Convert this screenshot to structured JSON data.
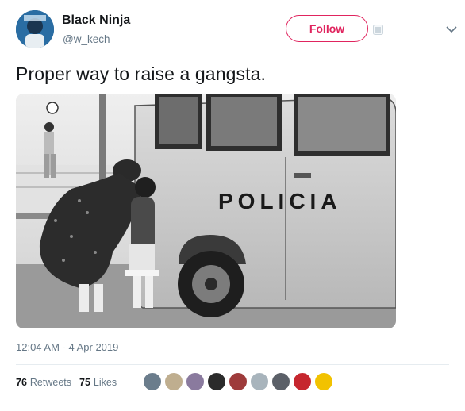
{
  "author": {
    "display_name": "Black Ninja",
    "handle": "@w_kech"
  },
  "follow_button": {
    "label": "Follow"
  },
  "tweet": {
    "text": "Proper way to raise a gangsta.",
    "media": {
      "van_text": "POLICIA"
    },
    "timestamp": "12:04 AM - 4 Apr 2019"
  },
  "stats": {
    "retweets_count": "76",
    "retweets_label": "Retweets",
    "likes_count": "75",
    "likes_label": "Likes"
  },
  "liker_avatars": [
    {
      "color": "#6b7d8c"
    },
    {
      "color": "#bfae8f"
    },
    {
      "color": "#8a7a9e"
    },
    {
      "color": "#2b2b2b"
    },
    {
      "color": "#9e3b3b"
    },
    {
      "color": "#a8b4bc"
    },
    {
      "color": "#5b6068"
    },
    {
      "color": "#c6262e"
    },
    {
      "color": "#f2c200"
    }
  ],
  "colors": {
    "accent": "#e0245e",
    "secondary_text": "#657786"
  }
}
